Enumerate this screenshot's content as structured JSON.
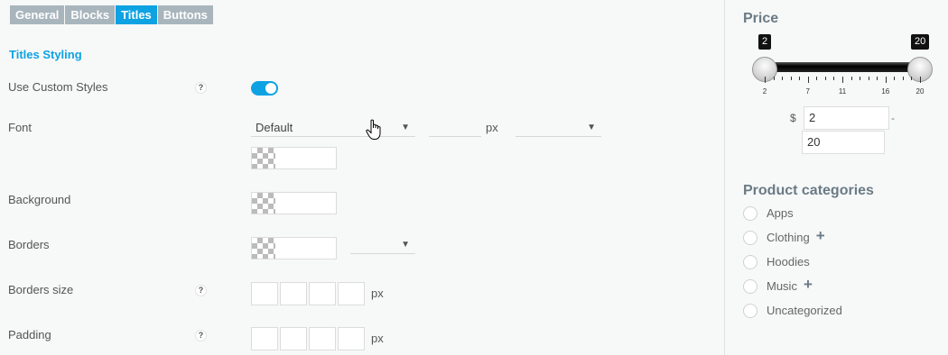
{
  "tabs": [
    {
      "label": "General",
      "active": false
    },
    {
      "label": "Blocks",
      "active": false
    },
    {
      "label": "Titles",
      "active": true
    },
    {
      "label": "Buttons",
      "active": false
    }
  ],
  "section_title": "Titles Styling",
  "help_glyph": "?",
  "rows": {
    "custom_styles": {
      "label": "Use Custom Styles",
      "enabled": true
    },
    "font": {
      "label": "Font",
      "family_value": "Default",
      "size_value": "",
      "size_unit": "px",
      "weight_value": ""
    },
    "background": {
      "label": "Background"
    },
    "borders": {
      "label": "Borders",
      "style_value": ""
    },
    "borders_size": {
      "label": "Borders size",
      "unit": "px"
    },
    "padding": {
      "label": "Padding",
      "unit": "px"
    }
  },
  "dropdown_glyph": "▼",
  "price_widget": {
    "title": "Price",
    "min_value": "2",
    "max_value": "20",
    "range_min": 2,
    "range_max": 20,
    "tick_labels": [
      "2",
      "7",
      "11",
      "16",
      "20"
    ],
    "currency": "$",
    "input_min": "2",
    "input_max": "20",
    "separator": "-"
  },
  "categories_widget": {
    "title": "Product categories",
    "items": [
      {
        "label": "Apps",
        "expandable": false
      },
      {
        "label": "Clothing",
        "expandable": true
      },
      {
        "label": "Hoodies",
        "expandable": false
      },
      {
        "label": "Music",
        "expandable": true
      },
      {
        "label": "Uncategorized",
        "expandable": false
      }
    ],
    "expand_glyph": "+"
  },
  "colors": {
    "accent": "#0ea2e3",
    "tab_inactive": "#a8b5bd",
    "widget_title": "#6b7b86"
  }
}
